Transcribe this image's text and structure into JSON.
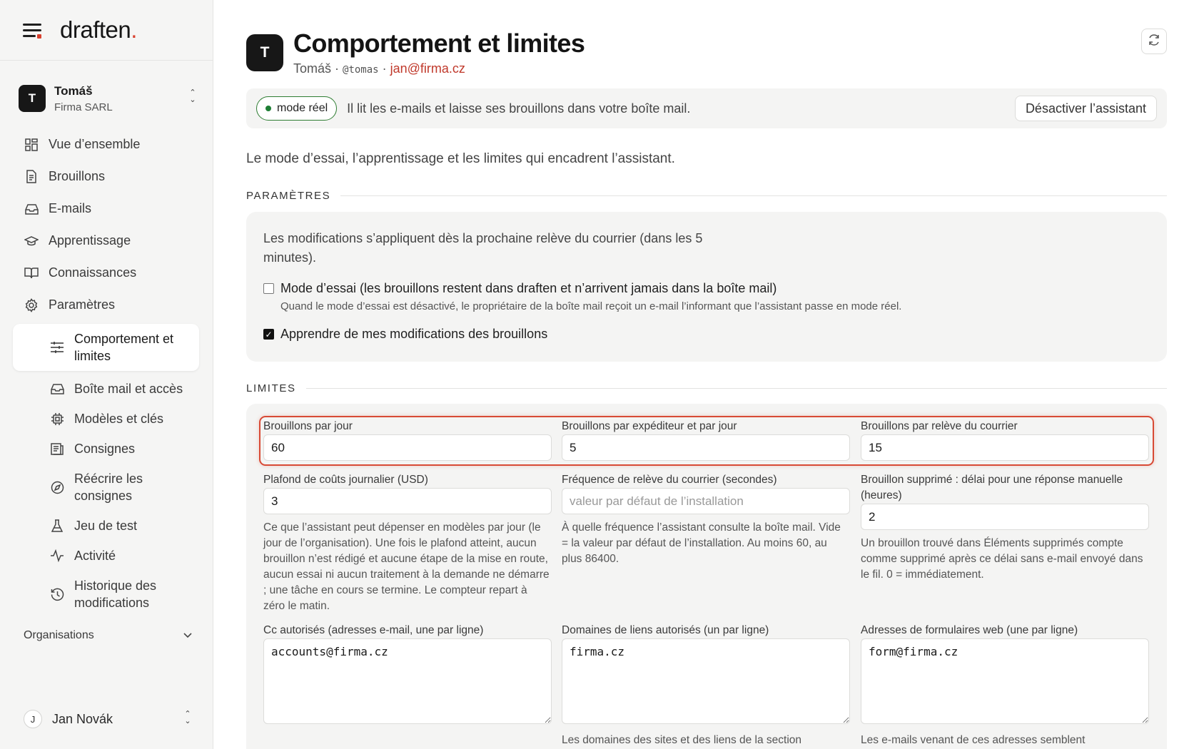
{
  "brand": {
    "name": "draften",
    "dot": "."
  },
  "account": {
    "initial": "T",
    "name": "Tomáš",
    "company": "Firma SARL"
  },
  "nav": [
    {
      "label": "Vue d’ensemble",
      "icon": "grid-icon"
    },
    {
      "label": "Brouillons",
      "icon": "document-icon"
    },
    {
      "label": "E-mails",
      "icon": "inbox-icon"
    },
    {
      "label": "Apprentissage",
      "icon": "graduation-cap-icon"
    },
    {
      "label": "Connaissances",
      "icon": "book-icon"
    },
    {
      "label": "Paramètres",
      "icon": "gear-icon"
    }
  ],
  "subnav": [
    {
      "label": "Comportement et limites",
      "icon": "sliders-icon",
      "active": true
    },
    {
      "label": "Boîte mail et accès",
      "icon": "inbox-icon"
    },
    {
      "label": "Modèles et clés",
      "icon": "chip-icon"
    },
    {
      "label": "Consignes",
      "icon": "list-icon"
    },
    {
      "label": "Réécrire les consignes",
      "icon": "compass-icon"
    },
    {
      "label": "Jeu de test",
      "icon": "flask-icon"
    },
    {
      "label": "Activité",
      "icon": "activity-icon"
    },
    {
      "label": "Historique des modifications",
      "icon": "history-icon"
    }
  ],
  "orgs": {
    "label": "Organisations"
  },
  "user": {
    "initial": "J",
    "name": "Jan Novák"
  },
  "header": {
    "initial": "T",
    "title": "Comportement et limites",
    "name": "Tomáš",
    "sep": " · ",
    "handle": "@tomas",
    "email": "jan@firma.cz"
  },
  "banner": {
    "pill": "mode réel",
    "message": "Il lit les e-mails et laisse ses brouillons dans votre boîte mail.",
    "button": "Désactiver l’assistant",
    "status_color": "#1e7e34"
  },
  "intro": "Le mode d’essai, l’apprentissage et les limites qui encadrent l’assistant.",
  "settings": {
    "heading": "PARAMÈTRES",
    "note": "Les modifications s’appliquent dès la prochaine relève du courrier (dans les 5 minutes).",
    "trial_label": "Mode d’essai (les brouillons restent dans draften et n’arrivent jamais dans la boîte mail)",
    "trial_hint": "Quand le mode d’essai est désactivé, le propriétaire de la boîte mail reçoit un e-mail l’informant que l’assistant passe en mode réel.",
    "trial_checked": false,
    "learn_label": "Apprendre de mes modifications des brouillons",
    "learn_checked": true
  },
  "limits": {
    "heading": "LIMITES",
    "per_day": {
      "label": "Brouillons par jour",
      "value": "60"
    },
    "per_sender": {
      "label": "Brouillons par expéditeur et par jour",
      "value": "5"
    },
    "per_fetch": {
      "label": "Brouillons par relève du courrier",
      "value": "15"
    },
    "cost_cap": {
      "label": "Plafond de coûts journalier (USD)",
      "value": "3",
      "help": "Ce que l’assistant peut dépenser en modèles par jour (le jour de l’organisation). Une fois le plafond atteint, aucun brouillon n’est rédigé et aucune étape de la mise en route, aucun essai ni aucun traitement à la demande ne démarre ; une tâche en cours se termine. Le compteur repart à zéro le matin."
    },
    "fetch_freq": {
      "label": "Fréquence de relève du courrier (secondes)",
      "placeholder": "valeur par défaut de l’installation",
      "help": "À quelle fréquence l’assistant consulte la boîte mail. Vide = la valeur par défaut de l’installation. Au moins 60, au plus 86400."
    },
    "deleted_delay": {
      "label": "Brouillon supprimé : délai pour une réponse manuelle (heures)",
      "value": "2",
      "help": "Un brouillon trouvé dans Éléments supprimés compte comme supprimé après ce délai sans e-mail envoyé dans le fil. 0 = immédiatement."
    },
    "cc": {
      "label": "Cc autorisés (adresses e-mail, une par ligne)",
      "value": "accounts@firma.cz"
    },
    "domains": {
      "label": "Domaines de liens autorisés (un par ligne)",
      "value": "firma.cz",
      "help": "Les domaines des sites et des liens de la section"
    },
    "forms": {
      "label": "Adresses de formulaires web (une par ligne)",
      "value": "form@firma.cz",
      "help": "Les e-mails venant de ces adresses semblent"
    }
  },
  "colors": {
    "accent": "#d8402e",
    "highlight": "#d84a35",
    "link": "#c0392b"
  }
}
